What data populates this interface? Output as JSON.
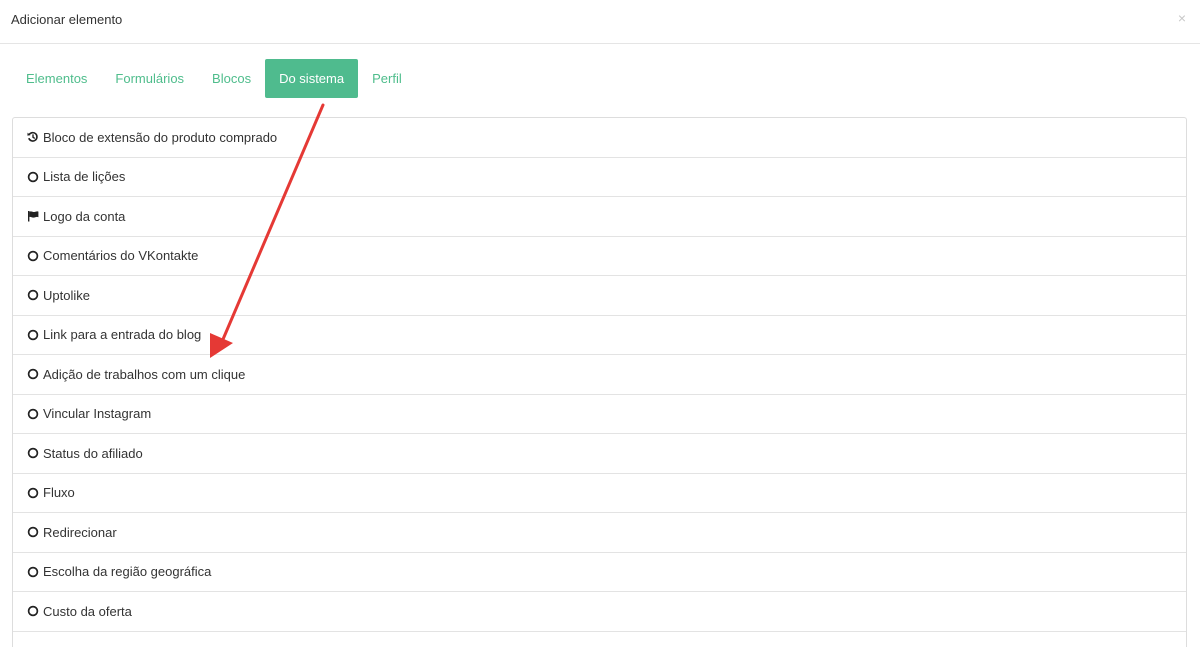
{
  "modal": {
    "title": "Adicionar elemento",
    "close_label": "×"
  },
  "tabs": [
    {
      "label": "Elementos",
      "active": false
    },
    {
      "label": "Formulários",
      "active": false
    },
    {
      "label": "Blocos",
      "active": false
    },
    {
      "label": "Do sistema",
      "active": true
    },
    {
      "label": "Perfil",
      "active": false
    }
  ],
  "items": [
    {
      "label": "Bloco de extensão do produto comprado",
      "icon": "history-icon"
    },
    {
      "label": "Lista de lições",
      "icon": "circle-icon"
    },
    {
      "label": "Logo da conta",
      "icon": "flag-icon"
    },
    {
      "label": "Comentários do VKontakte",
      "icon": "circle-icon"
    },
    {
      "label": "Uptolike",
      "icon": "circle-icon"
    },
    {
      "label": "Link para a entrada do blog",
      "icon": "circle-icon"
    },
    {
      "label": "Adição de trabalhos com um clique",
      "icon": "circle-icon"
    },
    {
      "label": "Vincular Instagram",
      "icon": "circle-icon"
    },
    {
      "label": "Status do afiliado",
      "icon": "circle-icon"
    },
    {
      "label": "Fluxo",
      "icon": "circle-icon"
    },
    {
      "label": "Redirecionar",
      "icon": "circle-icon"
    },
    {
      "label": "Escolha da região geográfica",
      "icon": "circle-icon"
    },
    {
      "label": "Custo da oferta",
      "icon": "circle-icon"
    },
    {
      "label": "",
      "icon": ""
    }
  ],
  "colors": {
    "accent": "#4fbb8e",
    "tab_text": "#4fbd8c",
    "annotation_arrow": "#e53935"
  }
}
